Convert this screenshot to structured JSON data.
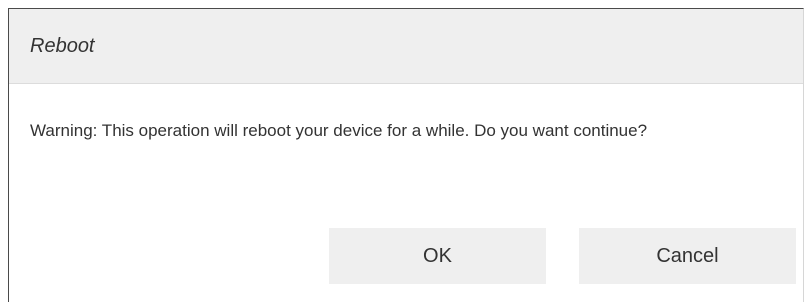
{
  "dialog": {
    "title": "Reboot",
    "message": "Warning: This operation will reboot your device for a while. Do you want continue?",
    "buttons": {
      "ok_label": "OK",
      "cancel_label": "Cancel"
    }
  },
  "colors": {
    "header_bg": "#efefef",
    "button_bg": "#efefef",
    "text": "#333333"
  }
}
